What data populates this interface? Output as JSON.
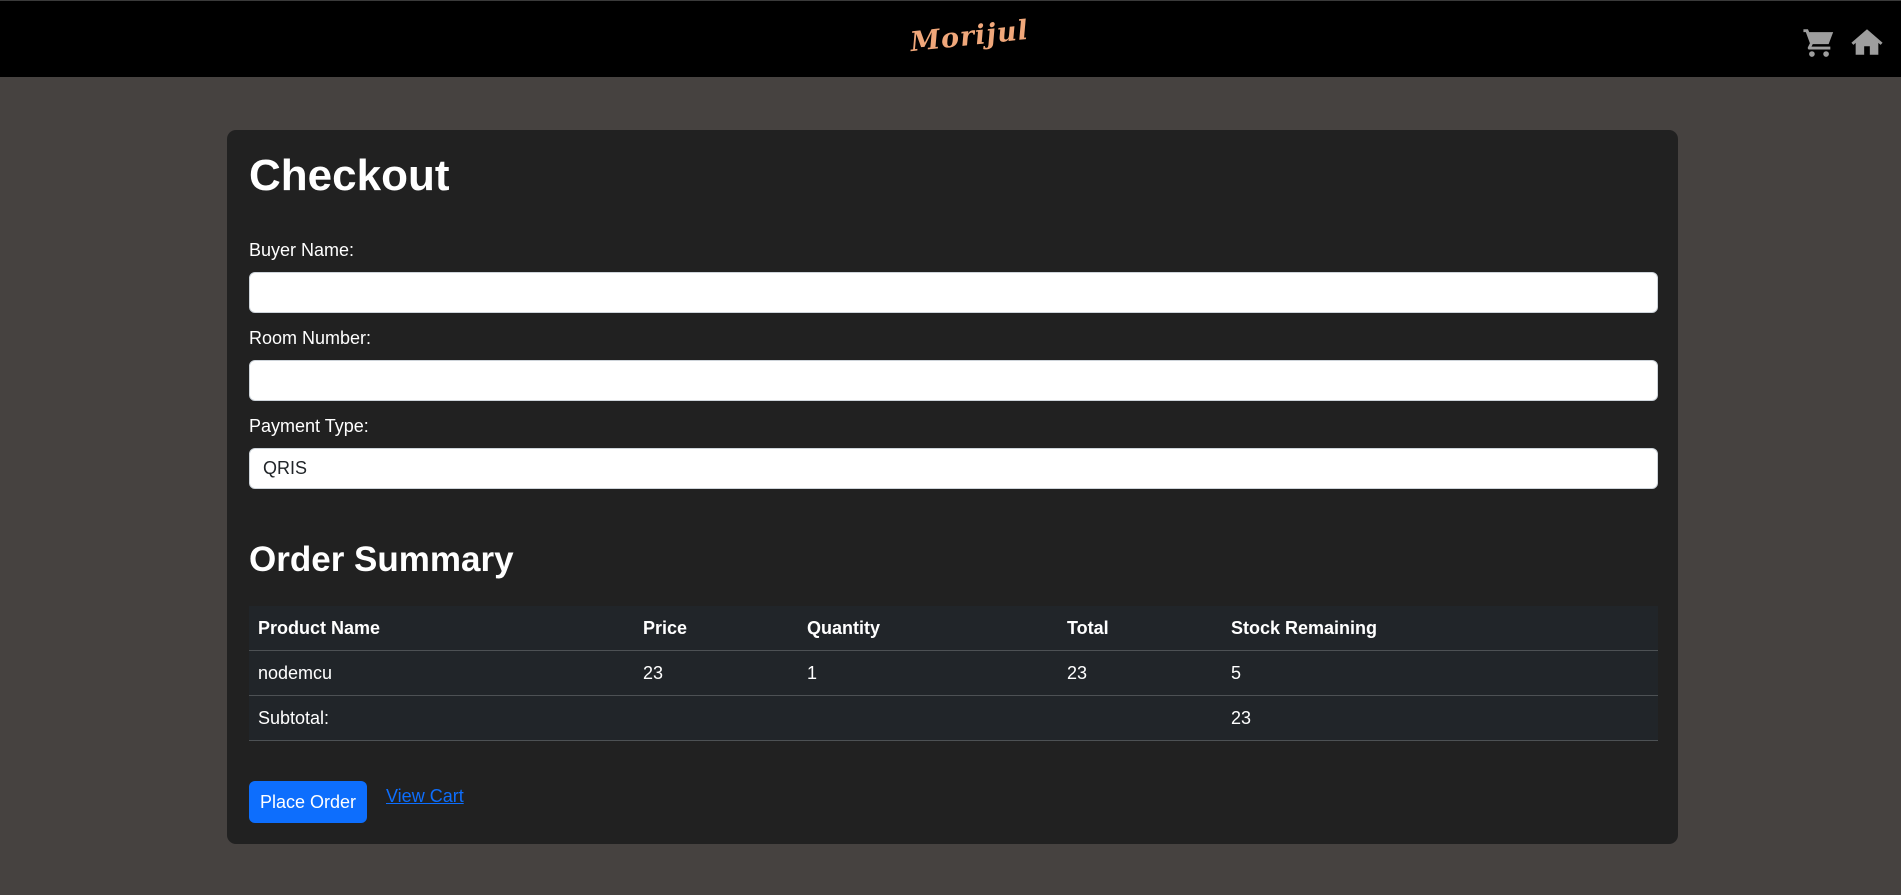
{
  "header": {
    "brand": "Morijul",
    "icons": [
      "cart-icon",
      "home-icon"
    ],
    "background": "#000000",
    "icon_color": "#9e9e9e"
  },
  "checkout": {
    "title": "Checkout",
    "buyer_name_label": "Buyer Name:",
    "buyer_name_value": "",
    "room_number_label": "Room Number:",
    "room_number_value": "",
    "payment_type_label": "Payment Type:",
    "payment_type_value": "QRIS"
  },
  "summary": {
    "title": "Order Summary",
    "columns": [
      "Product Name",
      "Price",
      "Quantity",
      "Total",
      "Stock Remaining"
    ],
    "rows": [
      {
        "product": "nodemcu",
        "price": "23",
        "quantity": "1",
        "total": "23",
        "stock": "5"
      }
    ],
    "subtotal_label": "Subtotal:",
    "subtotal_value": "23"
  },
  "actions": {
    "place_order": "Place Order",
    "view_cart": "View Cart"
  },
  "colors": {
    "page_bg": "#464240",
    "card_bg": "#212121",
    "primary": "#0d6efd",
    "brand": "#f0a77a"
  }
}
